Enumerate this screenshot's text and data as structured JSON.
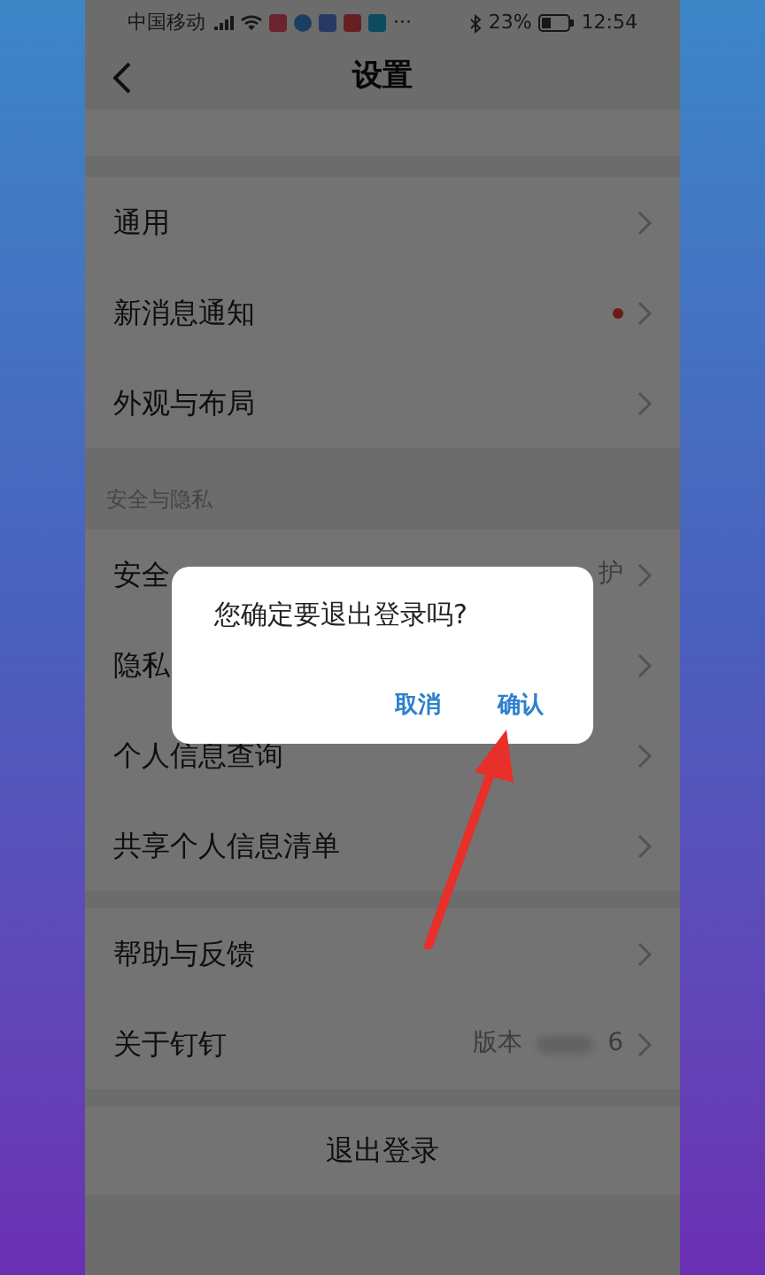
{
  "status_bar": {
    "carrier": "中国移动",
    "overflow": "···",
    "battery": "23%",
    "time": "12:54"
  },
  "header": {
    "title": "设置"
  },
  "groups": [
    {
      "items": [
        {
          "label": "通用",
          "badge": false
        },
        {
          "label": "新消息通知",
          "badge": true
        },
        {
          "label": "外观与布局",
          "badge": false
        }
      ]
    },
    {
      "title": "安全与隐私",
      "items": [
        {
          "label": "安全",
          "value": "护",
          "badge": false
        },
        {
          "label": "隐私",
          "badge": false
        },
        {
          "label": "个人信息查询",
          "badge": false
        },
        {
          "label": "共享个人信息清单",
          "badge": false
        }
      ]
    },
    {
      "items": [
        {
          "label": "帮助与反馈",
          "badge": false
        },
        {
          "label": "关于钉钉",
          "value": "版本",
          "value_tail": "6",
          "badge": false
        }
      ]
    }
  ],
  "logout": {
    "label": "退出登录"
  },
  "dialog": {
    "message": "您确定要退出登录吗?",
    "buttons": [
      {
        "label": "取消"
      },
      {
        "label": "确认"
      }
    ]
  }
}
